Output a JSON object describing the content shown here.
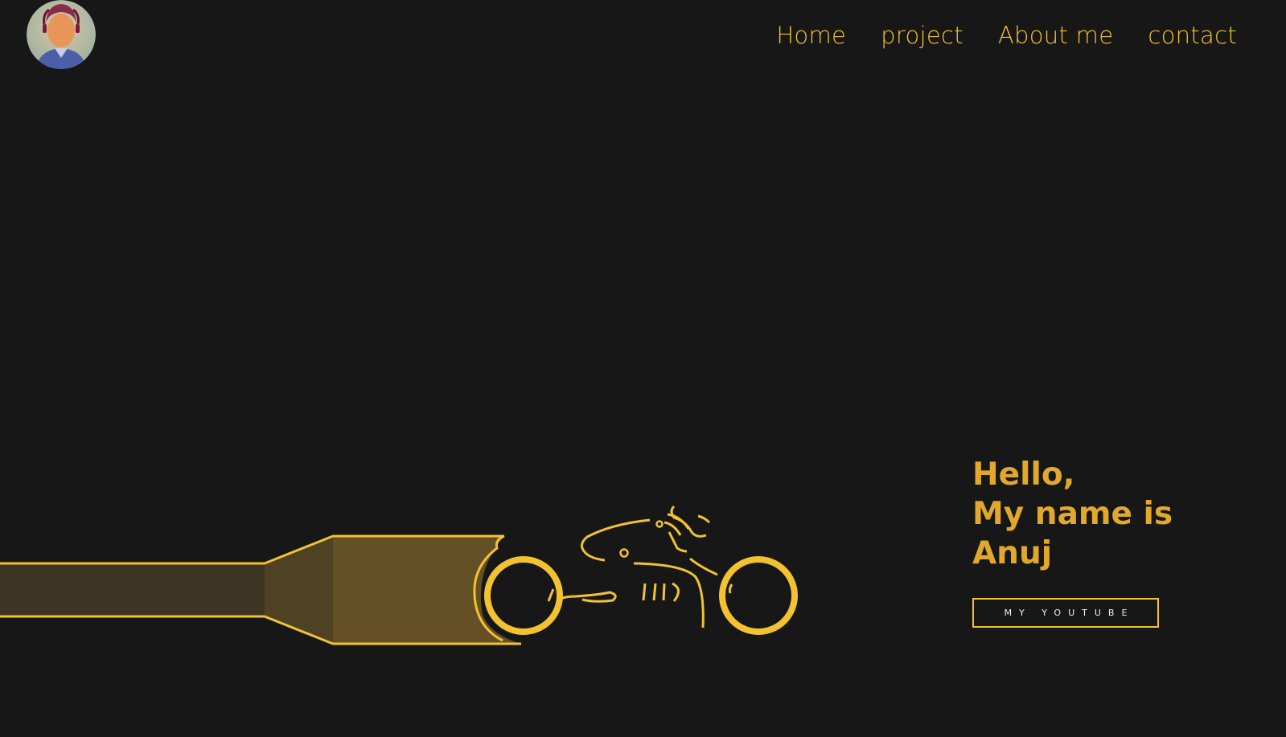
{
  "nav": {
    "items": [
      {
        "label": "Home"
      },
      {
        "label": "project"
      },
      {
        "label": "About me"
      },
      {
        "label": "contact"
      }
    ]
  },
  "hero": {
    "line1": "Hello,",
    "line2": "My name is",
    "line3": "Anuj",
    "button_label": "MY YOUTUBE"
  },
  "icons": {
    "avatar": "profile-photo",
    "illustration": "motorcycle-rider-illustration"
  },
  "colors": {
    "background": "#171717",
    "accent": "#f2c230",
    "heading": "#e2a82c",
    "button_text": "#f0f0f0"
  }
}
